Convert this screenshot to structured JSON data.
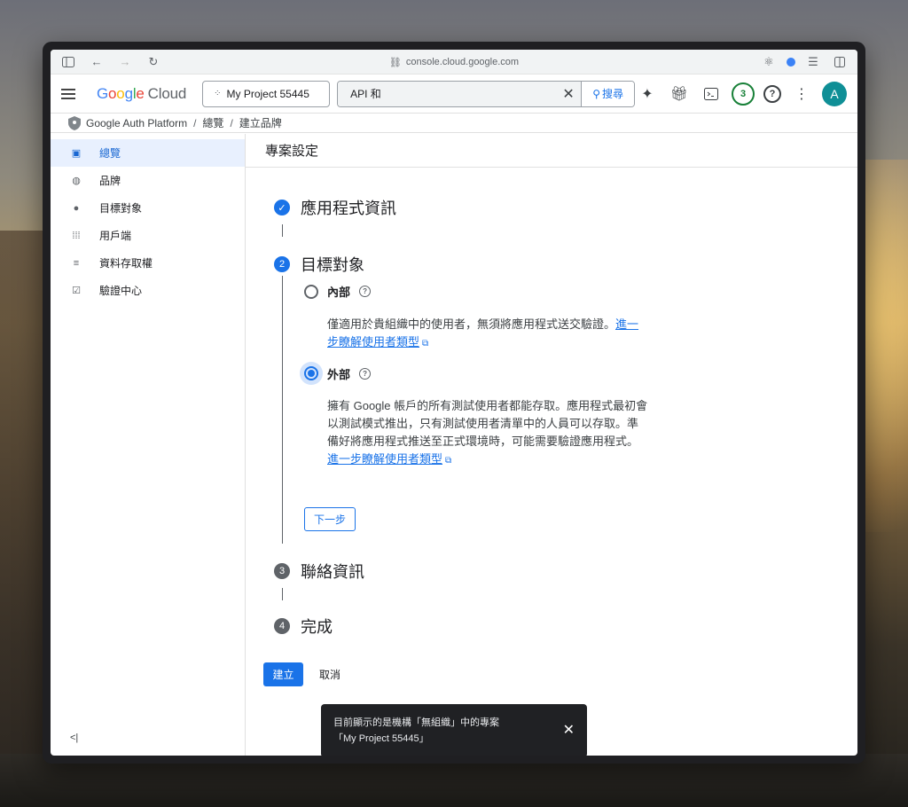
{
  "browser": {
    "url": "console.cloud.google.com"
  },
  "header": {
    "logo_google": "Google",
    "logo_cloud": "Cloud",
    "project": "My Project 55445",
    "search_value": "API 和",
    "search_button": "搜尋",
    "notifications_count": "3",
    "avatar_letter": "A"
  },
  "breadcrumb": {
    "items": [
      "Google Auth Platform",
      "總覽",
      "建立品牌"
    ],
    "separator": "/"
  },
  "sidebar": {
    "items": [
      {
        "label": "總覽",
        "icon": "dashboard-icon",
        "active": true
      },
      {
        "label": "品牌",
        "icon": "palette-icon",
        "active": false
      },
      {
        "label": "目標對象",
        "icon": "person-icon",
        "active": false
      },
      {
        "label": "用戶端",
        "icon": "grid-icon",
        "active": false
      },
      {
        "label": "資料存取權",
        "icon": "data-access-icon",
        "active": false
      },
      {
        "label": "驗證中心",
        "icon": "verification-icon",
        "active": false
      }
    ],
    "collapse": "<|"
  },
  "page": {
    "title": "專案設定",
    "steps": [
      {
        "num": "1",
        "title": "應用程式資訊",
        "state": "done"
      },
      {
        "num": "2",
        "title": "目標對象",
        "state": "active"
      },
      {
        "num": "3",
        "title": "聯絡資訊",
        "state": "pending"
      },
      {
        "num": "4",
        "title": "完成",
        "state": "pending"
      }
    ],
    "options": [
      {
        "label": "內部",
        "checked": false,
        "desc_line1": "僅適用於貴組織中的使用者，無須將應用程式送交驗證。",
        "link_part1": "進一",
        "link_part2": "步瞭解使用者類型"
      },
      {
        "label": "外部",
        "checked": true,
        "desc_line1": "擁有 Google 帳戶的所有測試使用者都能存取。應用程式最初會",
        "desc_line2": "以測試模式推出，只有測試使用者清單中的人員可以存取。準",
        "desc_line3": "備好將應用程式推送至正式環境時，可能需要驗證應用程式。",
        "link": "進一步瞭解使用者類型"
      }
    ],
    "next_button": "下一步",
    "create_button": "建立",
    "cancel_button": "取消"
  },
  "snackbar": {
    "line1": "目前顯示的是機構「無組織」中的專案",
    "line2": "「My Project 55445」"
  }
}
